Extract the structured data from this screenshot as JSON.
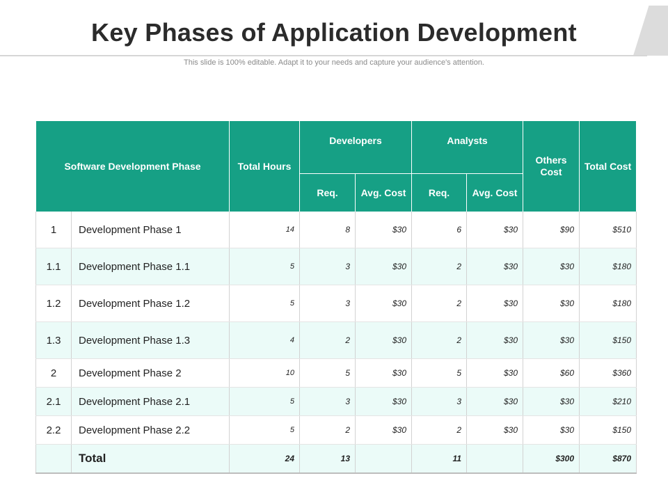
{
  "slide": {
    "title": "Key Phases of Application Development",
    "subtitle": "This slide is 100% editable. Adapt it to your needs and capture your audience's attention."
  },
  "table": {
    "headers": {
      "phase": "Software Development Phase",
      "total_hours": "Total Hours",
      "developers": "Developers",
      "analysts": "Analysts",
      "others_cost": "Others Cost",
      "total_cost": "Total Cost",
      "dev_req": "Req.",
      "dev_avg_cost": "Avg. Cost",
      "ana_req": "Req.",
      "ana_avg_cost": "Avg. Cost"
    },
    "rows": [
      {
        "index": "1",
        "phase": "Development Phase 1",
        "hours": "14",
        "dev_req": "8",
        "dev_avg": "$30",
        "ana_req": "6",
        "ana_avg": "$30",
        "others": "$90",
        "total": "$510"
      },
      {
        "index": "1.1",
        "phase": "Development Phase 1.1",
        "hours": "5",
        "dev_req": "3",
        "dev_avg": "$30",
        "ana_req": "2",
        "ana_avg": "$30",
        "others": "$30",
        "total": "$180"
      },
      {
        "index": "1.2",
        "phase": "Development Phase 1.2",
        "hours": "5",
        "dev_req": "3",
        "dev_avg": "$30",
        "ana_req": "2",
        "ana_avg": "$30",
        "others": "$30",
        "total": "$180"
      },
      {
        "index": "1.3",
        "phase": "Development Phase 1.3",
        "hours": "4",
        "dev_req": "2",
        "dev_avg": "$30",
        "ana_req": "2",
        "ana_avg": "$30",
        "others": "$30",
        "total": "$150"
      },
      {
        "index": "2",
        "phase": "Development Phase 2",
        "hours": "10",
        "dev_req": "5",
        "dev_avg": "$30",
        "ana_req": "5",
        "ana_avg": "$30",
        "others": "$60",
        "total": "$360"
      },
      {
        "index": "2.1",
        "phase": "Development Phase 2.1",
        "hours": "5",
        "dev_req": "3",
        "dev_avg": "$30",
        "ana_req": "3",
        "ana_avg": "$30",
        "others": "$30",
        "total": "$210"
      },
      {
        "index": "2.2",
        "phase": "Development Phase 2.2",
        "hours": "5",
        "dev_req": "2",
        "dev_avg": "$30",
        "ana_req": "2",
        "ana_avg": "$30",
        "others": "$30",
        "total": "$150"
      }
    ],
    "total_row": {
      "label": "Total",
      "hours": "24",
      "dev_req": "13",
      "ana_req": "11",
      "others": "$300",
      "total": "$870"
    }
  },
  "colors": {
    "header_bg": "#16a085",
    "alt_row_bg": "#ebfbf8",
    "title_text": "#2b2b2b"
  }
}
